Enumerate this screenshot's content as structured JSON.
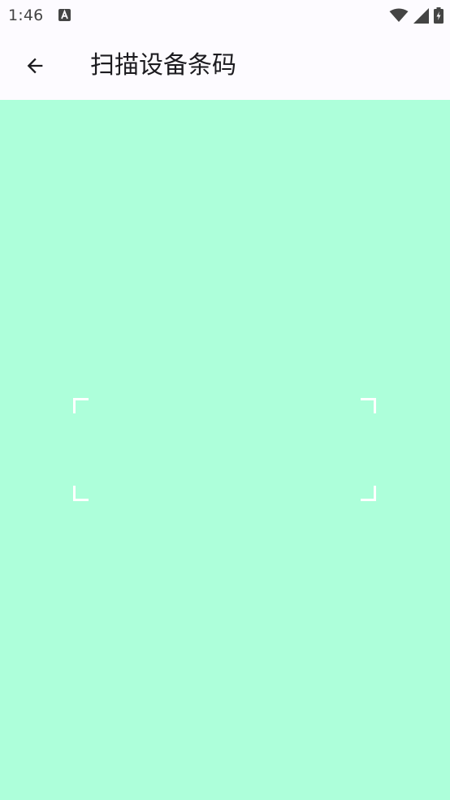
{
  "status_bar": {
    "time": "1:46",
    "icons": [
      "a-notification-icon",
      "wifi-icon",
      "signal-icon",
      "battery-charging-icon"
    ]
  },
  "app_bar": {
    "back_icon": "arrow-back-icon",
    "title": "扫描设备条码"
  },
  "scanner": {
    "background_color": "#adffda",
    "frame_corner_color": "#ffffff"
  }
}
